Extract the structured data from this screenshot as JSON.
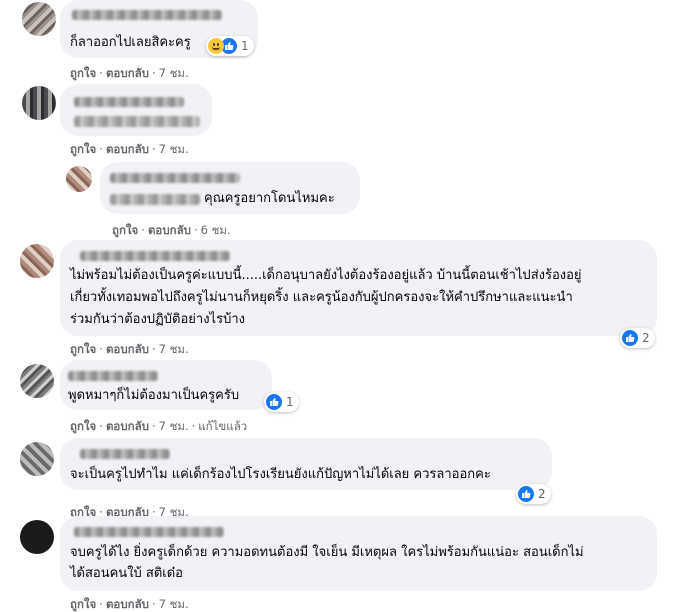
{
  "comments": [
    {
      "text": "ก็ลาออกไปเลยสิคะครู",
      "reaction_count": "1",
      "meta": {
        "like": "ถูกใจ",
        "reply": "ตอบกลับ",
        "time": "7 ชม."
      }
    },
    {
      "text": "",
      "meta": {
        "like": "ถูกใจ",
        "reply": "ตอบกลับ",
        "time": "7 ชม."
      }
    },
    {
      "text": "คุณครูอยากโดนไหมคะ",
      "meta": {
        "like": "ถูกใจ",
        "reply": "ตอบกลับ",
        "time": "6 ชม."
      }
    },
    {
      "lines": [
        "ไม่พร้อมไม่ต้องเป็นครูค่ะแบบนี้.....เด็กอนุบาลยังไงต้องร้องอยู่แล้ว บ้านนี้ตอนเช้าไปส่งร้องอยู่",
        "เกี่ยวทั้งเทอมพอไปถึงครูไม่นานก็หยุดริ้ง และครูน้องกับผู้ปกครองจะให้คำปรึกษาและแนะนำ",
        "ร่วมกันว่าต้องปฏิบัติอย่างไรบ้าง"
      ],
      "reaction_count": "2",
      "meta": {
        "like": "ถูกใจ",
        "reply": "ตอบกลับ",
        "time": "7 ชม."
      }
    },
    {
      "text": "พูดหมาๆก็ไม่ต้องมาเป็นครูครับ",
      "reaction_count": "1",
      "meta": {
        "like": "ถูกใจ",
        "reply": "ตอบกลับ",
        "time": "7 ชม.",
        "edited": "แก้ไขแล้ว"
      }
    },
    {
      "text": "จะเป็นครูไปทำไม แค่เด็กร้องไปโรงเรียนยังแก้ปัญหาไม่ได้เลย ควรลาออกคะ",
      "reaction_count": "2",
      "meta": {
        "like": "ถูกใจ",
        "reply": "ตอบกลับ",
        "time": "7 ชม."
      }
    },
    {
      "lines": [
        "จบครูได้ไง ยิ่งครูเด็กด้วย ความอดทนต้องมี ใจเย็น มีเหตุผล ใครไม่พร้อมกันแน่อะ สอนเด็กไม่",
        "ได้สอนคนใบ้ สติเด๋อ"
      ],
      "meta": {
        "like": "ถูกใจ",
        "reply": "ตอบกลับ",
        "time": "7 ชม."
      }
    }
  ],
  "icons": {
    "like": "thumbs-up-icon",
    "haha": "laughing-emoji-icon"
  },
  "colors": {
    "like_blue": "#1877f2",
    "bubble": "#f0f2f5",
    "meta_gray": "#65676b"
  }
}
